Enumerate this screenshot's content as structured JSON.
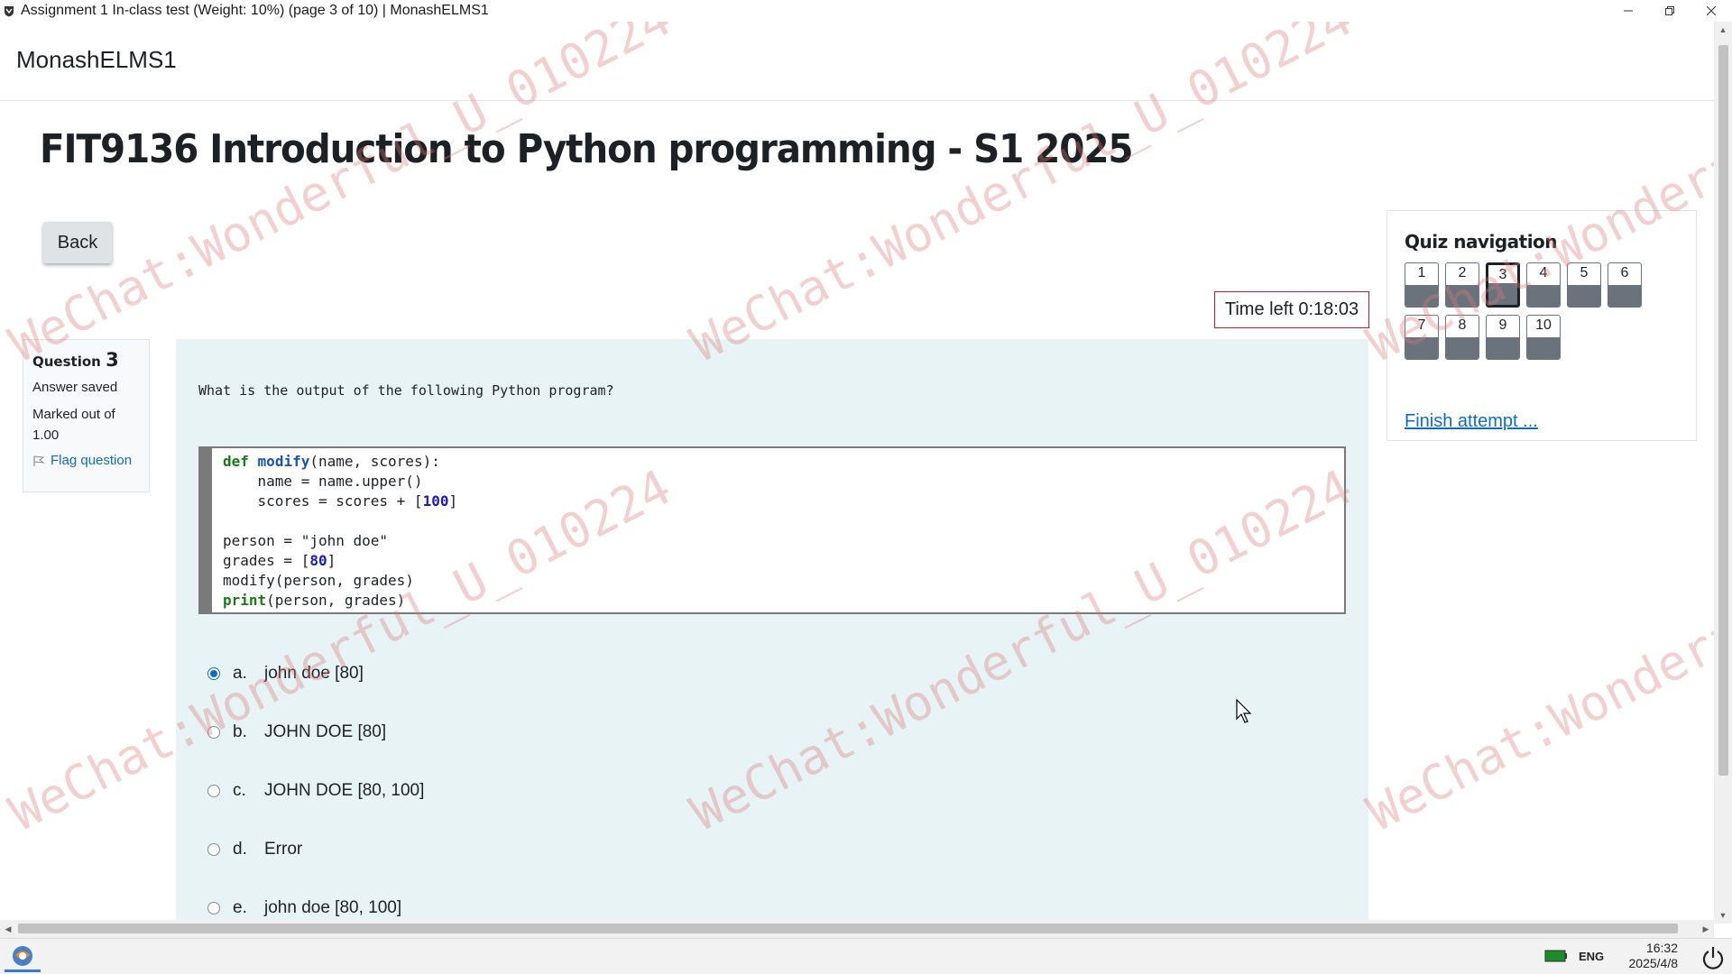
{
  "window": {
    "title": "Assignment 1 In-class test (Weight: 10%) (page 3 of 10) | MonashELMS1",
    "controls": [
      "minimize-icon",
      "restore-icon",
      "close-icon"
    ]
  },
  "header": {
    "site_name": "MonashELMS1"
  },
  "course": {
    "title": "FIT9136 Introduction to Python programming - S1 2025"
  },
  "back_button": "Back",
  "timer": {
    "text": "Time left 0:18:03"
  },
  "question_info": {
    "label": "Question",
    "number": "3",
    "state": "Answer saved",
    "grade": "Marked out of 1.00",
    "flag_label": "Flag question"
  },
  "question": {
    "text": "What is the output of the following Python program?",
    "code_lines": [
      [
        {
          "t": "def",
          "c": "kw"
        },
        {
          "t": " "
        },
        {
          "t": "modify",
          "c": "fn"
        },
        {
          "t": "(name, scores):"
        }
      ],
      [
        {
          "t": "    name = name.upper()"
        }
      ],
      [
        {
          "t": "    scores = scores + ["
        },
        {
          "t": "100",
          "c": "num-lit"
        },
        {
          "t": "]"
        }
      ],
      [
        {
          "t": ""
        }
      ],
      [
        {
          "t": "person = \"john doe\""
        }
      ],
      [
        {
          "t": "grades = ["
        },
        {
          "t": "80",
          "c": "num-lit"
        },
        {
          "t": "]"
        }
      ],
      [
        {
          "t": "modify(person, grades)"
        }
      ],
      [
        {
          "t": "print",
          "c": "kw"
        },
        {
          "t": "(person, grades)"
        }
      ]
    ],
    "answers": [
      {
        "letter": "a.",
        "text": "john doe [80]",
        "checked": true
      },
      {
        "letter": "b.",
        "text": "JOHN DOE [80]",
        "checked": false
      },
      {
        "letter": "c.",
        "text": "JOHN DOE [80, 100]",
        "checked": false
      },
      {
        "letter": "d.",
        "text": "Error",
        "checked": false
      },
      {
        "letter": "e.",
        "text": "john doe [80, 100]",
        "checked": false
      }
    ]
  },
  "quiz_navigation": {
    "heading": "Quiz navigation",
    "questions": [
      {
        "label": "1",
        "answered": true,
        "current": false
      },
      {
        "label": "2",
        "answered": true,
        "current": false
      },
      {
        "label": "3",
        "answered": true,
        "current": true
      },
      {
        "label": "4",
        "answered": true,
        "current": false
      },
      {
        "label": "5",
        "answered": true,
        "current": false
      },
      {
        "label": "6",
        "answered": true,
        "current": false
      },
      {
        "label": "7",
        "answered": true,
        "current": false
      },
      {
        "label": "8",
        "answered": true,
        "current": false
      },
      {
        "label": "9",
        "answered": true,
        "current": false
      },
      {
        "label": "10",
        "answered": true,
        "current": false
      }
    ],
    "finish_link": "Finish attempt ..."
  },
  "watermark": {
    "text": "WeChat:Wonderful_U_010224",
    "color": "#dc7878"
  },
  "taskbar": {
    "lang": "ENG",
    "time": "16:32",
    "date": "2025/4/8"
  },
  "colors": {
    "accent": "#0f6cbf",
    "question_bg": "#e7f3f5",
    "timer_border": "#c41a2a",
    "answered": "#6a737b"
  }
}
